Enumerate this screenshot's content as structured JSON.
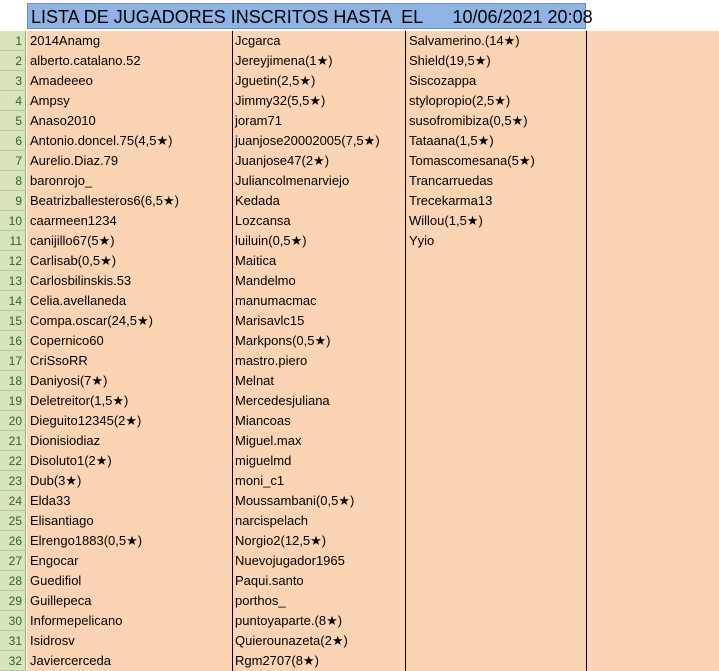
{
  "title": {
    "label": "LISTA DE JUGADORES INSCRITOS HASTA  EL",
    "date": "10/06/2021 20:08"
  },
  "row_numbers": [
    "1",
    "2",
    "3",
    "4",
    "5",
    "6",
    "7",
    "8",
    "9",
    "10",
    "11",
    "12",
    "13",
    "14",
    "15",
    "16",
    "17",
    "18",
    "19",
    "20",
    "21",
    "22",
    "23",
    "24",
    "25",
    "26",
    "27",
    "28",
    "29",
    "30",
    "31",
    "32"
  ],
  "columns": [
    [
      "2014Anamg",
      "alberto.catalano.52",
      "Amadeeeo",
      "Ampsy",
      "Anaso2010",
      "Antonio.doncel.75(4,5★)",
      "Aurelio.Diaz.79",
      "baronrojo_",
      "Beatrizballesteros6(6,5★)",
      "caarmeen1234",
      "canijillo67(5★)",
      "Carlisab(0,5★)",
      "Carlosbilinskis.53",
      "Celia.avellaneda",
      "Compa.oscar(24,5★)",
      "Copernico60",
      "CriSsoRR",
      "Daniyosi(7★)",
      "Deletreitor(1,5★)",
      "Dieguito12345(2★)",
      "Dionisiodiaz",
      "Disoluto1(2★)",
      "Dub(3★)",
      "Elda33",
      "Elisantiago",
      "Elrengo1883(0,5★)",
      "Engocar",
      "Guedifiol",
      "Guillepeca",
      "Informepelicano",
      "Isidrosv",
      "Javiercerceda"
    ],
    [
      "Jcgarca",
      "Jereyjimena(1★)",
      "Jguetin(2,5★)",
      "Jimmy32(5,5★)",
      "joram71",
      "juanjose20002005(7,5★)",
      "Juanjose47(2★)",
      "Juliancolmenarviejo",
      "Kedada",
      "Lozcansa",
      "luiluin(0,5★)",
      "Maitica",
      "Mandelmo",
      "manumacmac",
      "Marisavlc15",
      "Markpons(0,5★)",
      "mastro.piero",
      "Melnat",
      "Mercedesjuliana",
      "Miancoas",
      "Miguel.max",
      "miguelmd",
      "moni_c1",
      "Moussambani(0,5★)",
      "narcispelach",
      "Norgio2(12,5★)",
      "Nuevojugador1965",
      "Paqui.santo",
      "porthos_",
      "puntoyaparte.(8★)",
      "Quierounazeta(2★)",
      "Rgm2707(8★)"
    ],
    [
      "Salvamerino.(14★)",
      "Shield(19,5★)",
      "Siscozappa",
      "stylopropio(2,5★)",
      "susofromibiza(0,5★)",
      "Tataana(1,5★)",
      "Tomascomesana(5★)",
      "Trancarruedas",
      "Trecekarma13",
      "Willou(1,5★)",
      "Yyio"
    ],
    []
  ]
}
